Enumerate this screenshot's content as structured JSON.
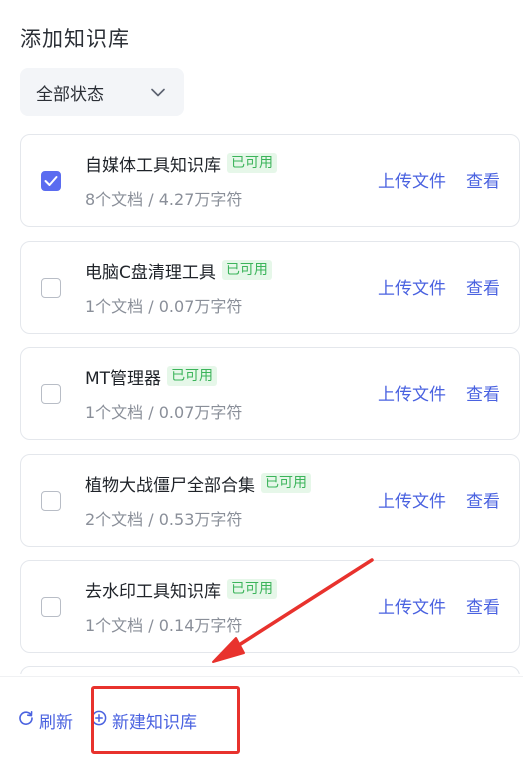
{
  "panel": {
    "title": "添加知识库",
    "status_filter": {
      "selected": "全部状态"
    }
  },
  "knowledge_bases": [
    {
      "name": "自媒体工具知识库",
      "status": "已可用",
      "meta": "8个文档 / 4.27万字符",
      "checked": true,
      "upload_label": "上传文件",
      "view_label": "查看"
    },
    {
      "name": "电脑C盘清理工具",
      "status": "已可用",
      "meta": "1个文档 / 0.07万字符",
      "checked": false,
      "upload_label": "上传文件",
      "view_label": "查看"
    },
    {
      "name": "MT管理器",
      "status": "已可用",
      "meta": "1个文档 / 0.07万字符",
      "checked": false,
      "upload_label": "上传文件",
      "view_label": "查看"
    },
    {
      "name": "植物大战僵尸全部合集",
      "status": "已可用",
      "meta": "2个文档 / 0.53万字符",
      "checked": false,
      "upload_label": "上传文件",
      "view_label": "查看"
    },
    {
      "name": "去水印工具知识库",
      "status": "已可用",
      "meta": "1个文档 / 0.14万字符",
      "checked": false,
      "upload_label": "上传文件",
      "view_label": "查看"
    }
  ],
  "footer": {
    "refresh_label": "刷新",
    "new_kb_label": "新建知识库",
    "refresh_icon": "refresh-icon",
    "new_icon": "plus-circle-icon"
  },
  "colors": {
    "accent": "#4a62e0",
    "checkbox_checked": "#5b6cf0",
    "badge_text": "#3bb45a",
    "badge_bg": "#e6f7e9",
    "annotation_red": "#e8322d"
  }
}
